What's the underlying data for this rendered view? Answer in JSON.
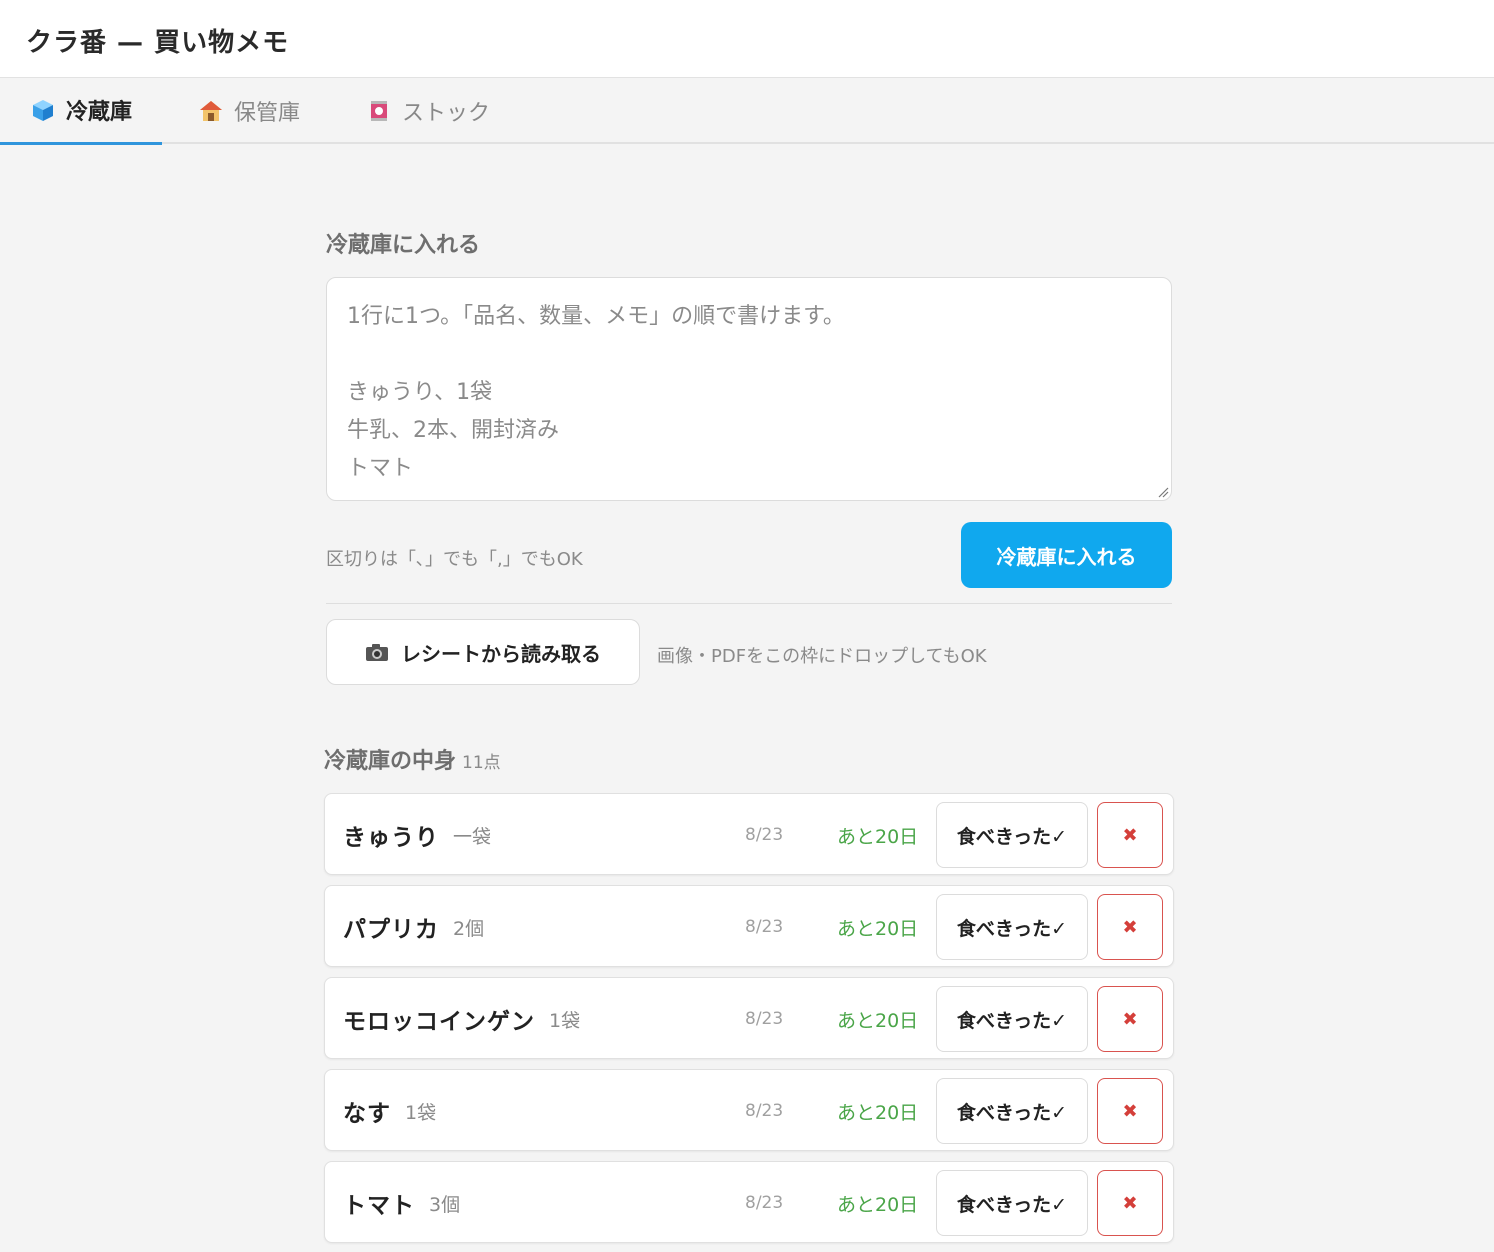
{
  "app": {
    "title": "クラ番 — 買い物メモ"
  },
  "tabs": [
    {
      "label": "冷蔵庫",
      "icon": "ice-cube-icon",
      "active": true
    },
    {
      "label": "保管庫",
      "icon": "house-icon",
      "active": false
    },
    {
      "label": "ストック",
      "icon": "can-icon",
      "active": false
    }
  ],
  "add_section": {
    "title": "冷蔵庫に入れる",
    "textarea_placeholder": "1行に1つ。「品名、数量、メモ」の順で書けます。\n\nきゅうり、1袋\n牛乳、2本、開封済み\nトマト",
    "hint": "区切りは「､」でも「,」でもOK",
    "submit_label": "冷蔵庫に入れる"
  },
  "receipt": {
    "button_label": "レシートから読み取る",
    "icon": "camera-icon",
    "hint": "画像・PDFをこの枠にドロップしてもOK"
  },
  "inventory": {
    "title": "冷蔵庫の中身",
    "count": "11点",
    "items": [
      {
        "name": "きゅうり",
        "qty": "一袋",
        "date": "8/23",
        "remaining": "あと20日",
        "ate_label": "食べきった✓",
        "delete_label": "✖"
      },
      {
        "name": "パプリカ",
        "qty": "2個",
        "date": "8/23",
        "remaining": "あと20日",
        "ate_label": "食べきった✓",
        "delete_label": "✖"
      },
      {
        "name": "モロッコインゲン",
        "qty": "1袋",
        "date": "8/23",
        "remaining": "あと20日",
        "ate_label": "食べきった✓",
        "delete_label": "✖"
      },
      {
        "name": "なす",
        "qty": "1袋",
        "date": "8/23",
        "remaining": "あと20日",
        "ate_label": "食べきった✓",
        "delete_label": "✖"
      },
      {
        "name": "トマト",
        "qty": "3個",
        "date": "8/23",
        "remaining": "あと20日",
        "ate_label": "食べきった✓",
        "delete_label": "✖"
      }
    ]
  },
  "colors": {
    "accent": "#2f95dc",
    "primary_button": "#10a8ee",
    "remaining_text": "#4aa548",
    "delete_red": "#d43f3a",
    "background": "#f4f4f4"
  }
}
